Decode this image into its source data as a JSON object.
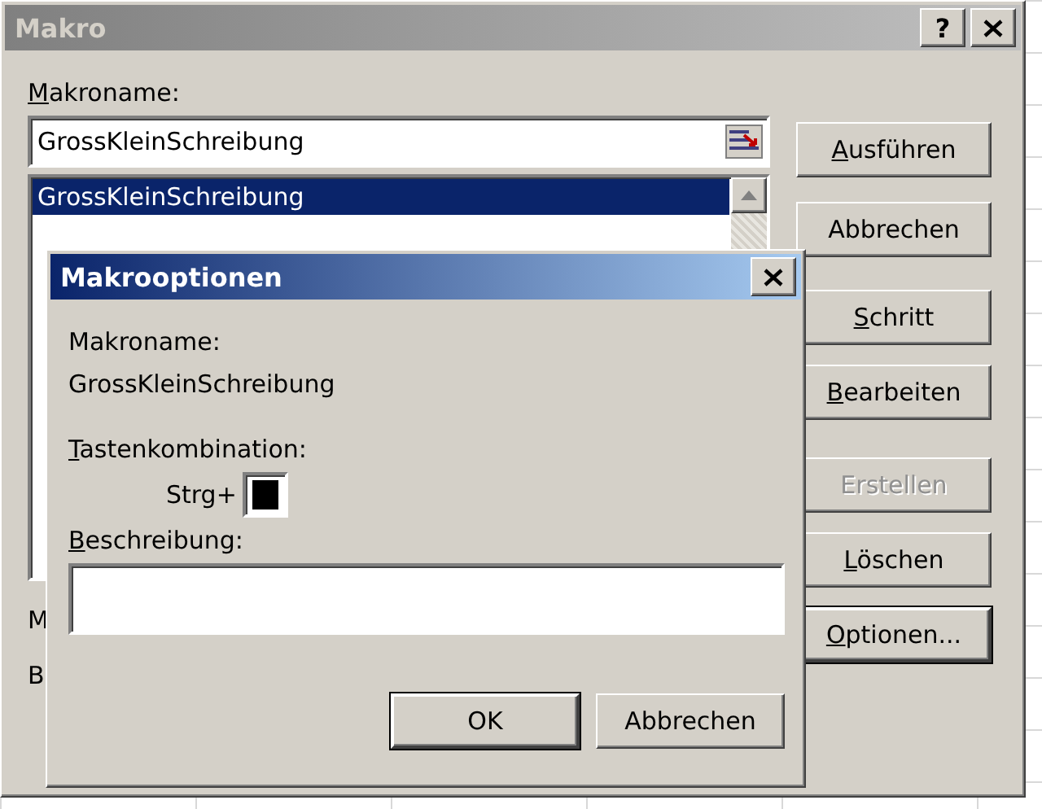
{
  "window": {
    "title": "Makro",
    "active": false,
    "help_button": "?"
  },
  "macro_name": {
    "label": {
      "key": "M",
      "rest": "akroname:"
    },
    "value": "GrossKleinSchreibung"
  },
  "macro_list": {
    "items": [
      {
        "name": "GrossKleinSchreibung",
        "selected": true
      }
    ]
  },
  "buttons": [
    {
      "key": "A",
      "rest": "usführen",
      "disabled": false,
      "default": false
    },
    {
      "rest": "Abbrechen",
      "disabled": false,
      "default": false
    },
    {
      "key": "S",
      "rest": "chritt",
      "disabled": false,
      "default": false
    },
    {
      "key": "B",
      "rest": "earbeiten",
      "disabled": false,
      "default": false
    },
    {
      "rest": "Erstellen",
      "disabled": true,
      "default": false
    },
    {
      "key": "L",
      "rest": "öschen",
      "disabled": false,
      "default": false
    },
    {
      "key": "O",
      "rest": "ptionen...",
      "disabled": false,
      "default": true
    }
  ],
  "covered_labels": [
    "M",
    "B"
  ],
  "options_dialog": {
    "title": "Makrooptionen",
    "active": true,
    "macro_name_label": "Makroname:",
    "macro_name": "GrossKleinSchreibung",
    "shortcut_label": {
      "key": "T",
      "rest": "astenkombination:"
    },
    "shortcut_prefix": "Strg+",
    "shortcut_selected": true,
    "description_label": {
      "key": "B",
      "rest": "eschreibung:"
    },
    "buttons": [
      {
        "rest": "OK",
        "default": true
      },
      {
        "rest": "Abbrechen",
        "default": false
      }
    ]
  }
}
